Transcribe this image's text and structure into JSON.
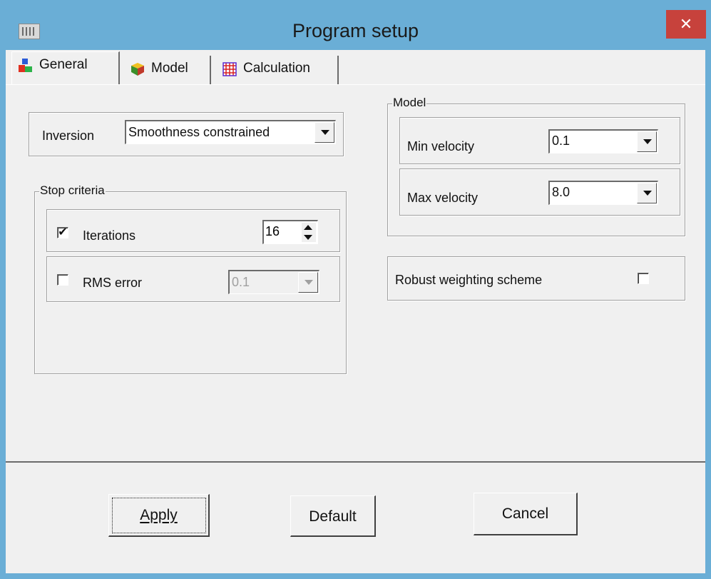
{
  "window": {
    "title": "Program setup",
    "close_symbol": "✕"
  },
  "tabs": [
    {
      "label": "General",
      "icon": "blocks-icon",
      "selected": true
    },
    {
      "label": "Model",
      "icon": "cube-icon",
      "selected": false
    },
    {
      "label": "Calculation",
      "icon": "grid-icon",
      "selected": false
    }
  ],
  "general": {
    "inversion": {
      "label": "Inversion",
      "value": "Smoothness constrained"
    },
    "stop_criteria": {
      "title": "Stop criteria",
      "iterations": {
        "label": "Iterations",
        "checked": true,
        "check_glyph": "✔",
        "value": "16"
      },
      "rms_error": {
        "label": "RMS error",
        "checked": false,
        "value": "0.1"
      }
    },
    "model": {
      "title": "Model",
      "min_velocity": {
        "label": "Min velocity",
        "value": "0.1"
      },
      "max_velocity": {
        "label": "Max velocity",
        "value": "8.0"
      }
    },
    "robust": {
      "label": "Robust weighting scheme",
      "checked": false
    }
  },
  "buttons": {
    "apply": "Apply",
    "default": "Default",
    "cancel": "Cancel"
  },
  "colors": {
    "titlebar": "#6aaed6",
    "close": "#c7423c",
    "face": "#f0f0f0"
  }
}
